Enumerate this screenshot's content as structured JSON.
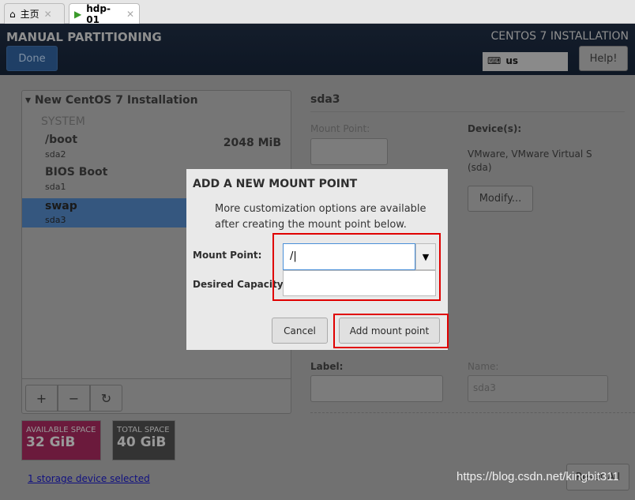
{
  "tabs": [
    {
      "label": "主页",
      "icon": "home-icon"
    },
    {
      "label": "hdp-01",
      "icon": "vm-running-icon"
    }
  ],
  "header": {
    "title": "MANUAL PARTITIONING",
    "done": "Done",
    "product": "CENTOS 7 INSTALLATION",
    "keyboard": "us",
    "help": "Help!"
  },
  "left": {
    "group": "New CentOS 7 Installation",
    "section": "SYSTEM",
    "items": [
      {
        "name": "/boot",
        "dev": "sda2",
        "size": "2048 MiB"
      },
      {
        "name": "BIOS Boot",
        "dev": "sda1"
      },
      {
        "name": "swap",
        "dev": "sda3",
        "selected": true
      }
    ],
    "add": "+",
    "remove": "−",
    "refresh": "↻"
  },
  "space": {
    "avail_label": "AVAILABLE SPACE",
    "avail": "32 GiB",
    "total_label": "TOTAL SPACE",
    "total": "40 GiB",
    "avail_color": "#6b1a3c"
  },
  "storage_link": "1 storage device selected",
  "right": {
    "title": "sda3",
    "mount_label": "Mount Point:",
    "devices_label": "Device(s):",
    "devices": "VMware, VMware Virtual S",
    "devices2": "(sda)",
    "modify": "Modify...",
    "label_label": "Label:",
    "name_label": "Name:",
    "name_value": "sda3",
    "reset": "Reset All"
  },
  "dialog": {
    "title": "ADD A NEW MOUNT POINT",
    "desc1": "More customization options are available",
    "desc2": "after creating the mount point below.",
    "mount_label": "Mount Point:",
    "mount_value": "/",
    "capacity_label": "Desired Capacity:",
    "capacity_value": "",
    "cancel": "Cancel",
    "add": "Add mount point"
  },
  "watermark": "https://blog.csdn.net/kingbit311"
}
